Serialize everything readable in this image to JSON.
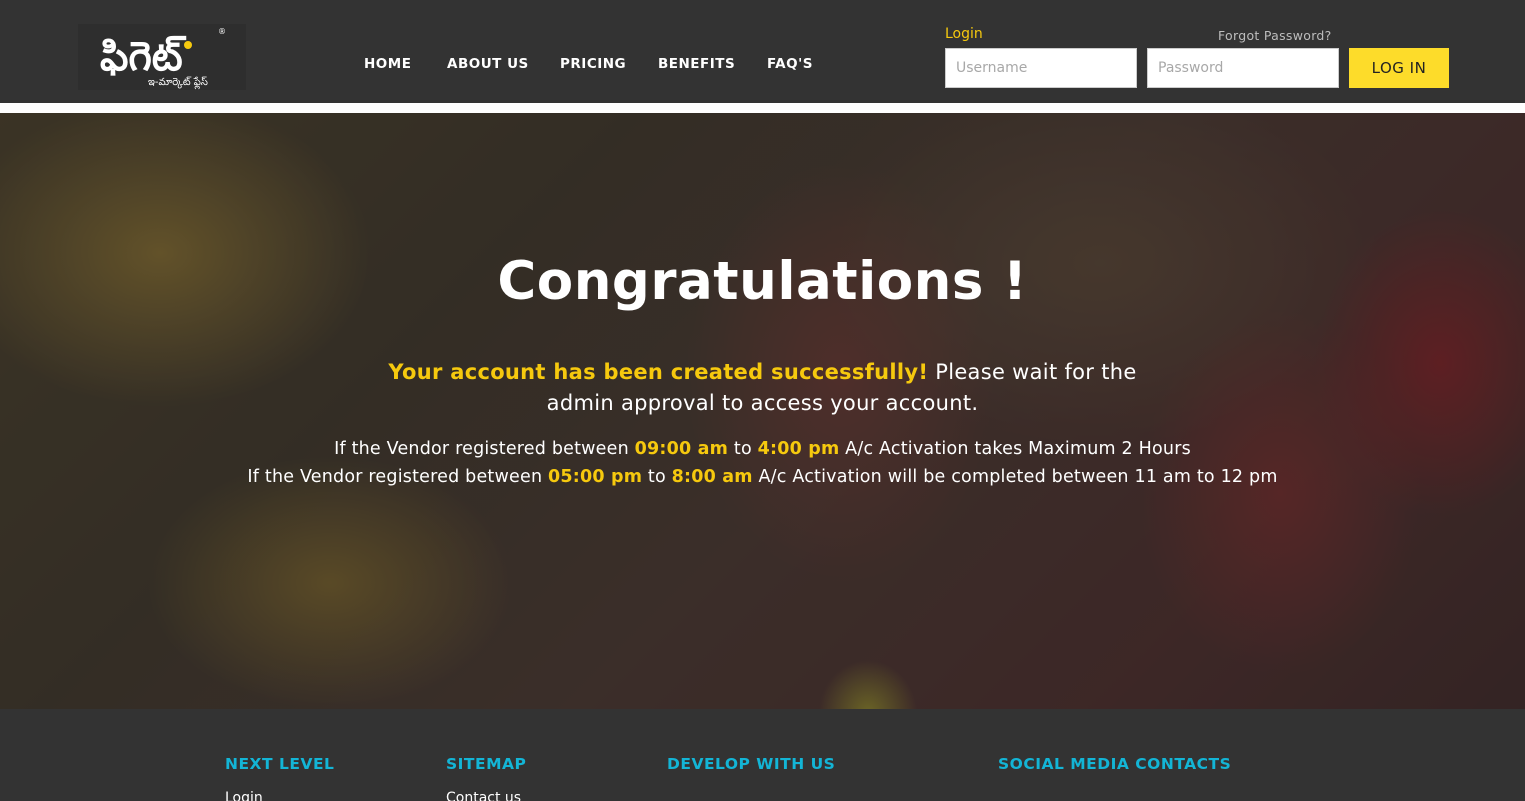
{
  "header": {
    "logo": {
      "text_main": "ఫిగెట్",
      "text_sub": "ఇ-మార్కెట్ ఫ్లేస్",
      "registered": "®",
      "accent_color": "#f6c90e"
    },
    "nav": {
      "home": "HOME",
      "about": "ABOUT US",
      "pricing": "PRICING",
      "benefits": "BENEFITS",
      "faqs": "FAQ'S"
    },
    "login": {
      "label": "Login",
      "forgot": "Forgot Password?",
      "username_placeholder": "Username",
      "password_placeholder": "Password",
      "button": "LOG IN"
    }
  },
  "hero": {
    "title": "Congratulations !",
    "message_highlight": "Your account has been created successfully!",
    "message_rest": " Please wait for the admin approval to access your account.",
    "line1": {
      "prefix": "If the Vendor registered between ",
      "start": "09:00 am",
      "mid": " to ",
      "end": "4:00 pm",
      "suffix": " A/c Activation takes Maximum 2 Hours"
    },
    "line2": {
      "prefix": "If the Vendor registered between ",
      "start": "05:00 pm",
      "mid": " to ",
      "end": "8:00 am",
      "suffix": " A/c Activation will be completed between 11 am to 12 pm"
    },
    "highlight_color": "#f6c90e"
  },
  "footer": {
    "headings": {
      "next_level": "NEXT LEVEL",
      "sitemap": "SITEMAP",
      "develop": "DEVELOP WITH US",
      "social": "SOCIAL MEDIA CONTACTS"
    },
    "links": {
      "login": "Login",
      "contact": "Contact us"
    },
    "heading_color": "#13b5d6"
  }
}
